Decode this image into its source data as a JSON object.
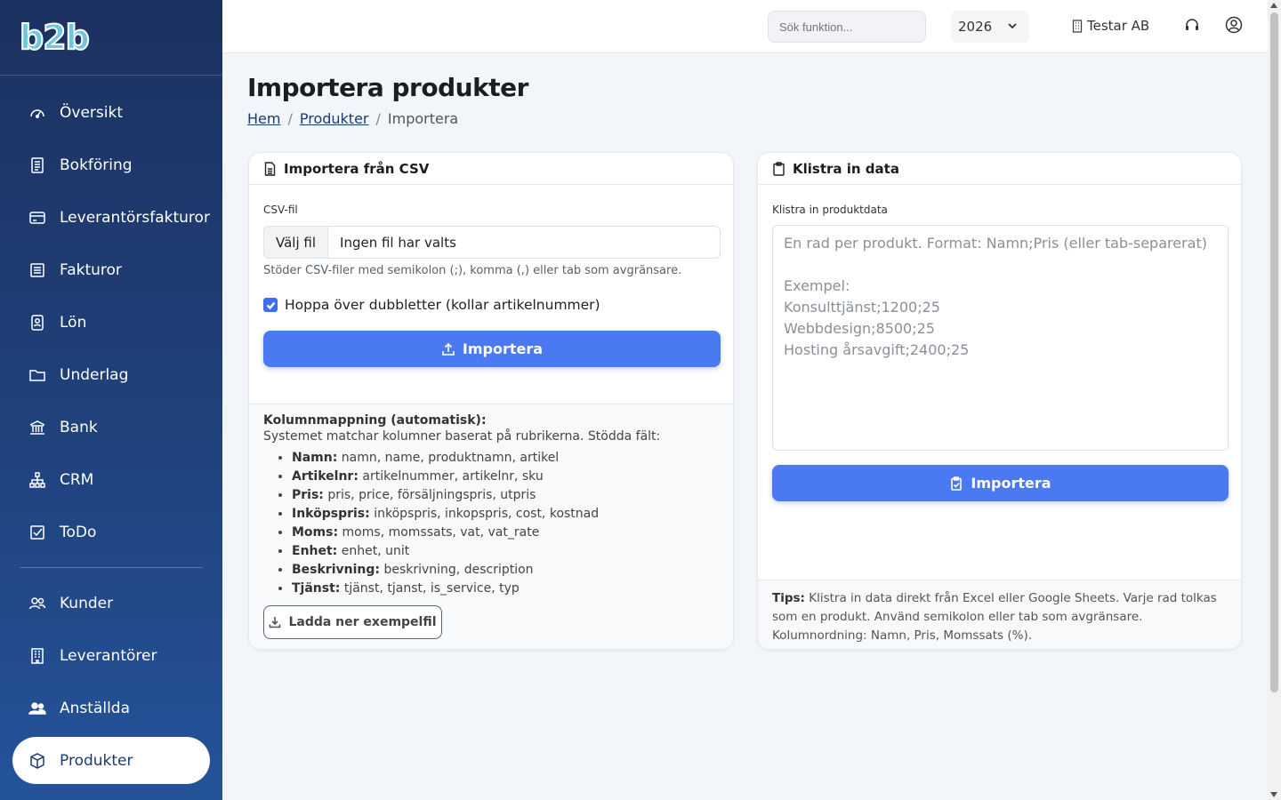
{
  "brand": {
    "logo_text": "b2b"
  },
  "sidebar": {
    "items": [
      {
        "label": "Översikt",
        "icon": "gauge-icon"
      },
      {
        "label": "Bokföring",
        "icon": "ledger-icon"
      },
      {
        "label": "Leverantörsfakturor",
        "icon": "credit-card-icon"
      },
      {
        "label": "Fakturor",
        "icon": "invoice-icon"
      },
      {
        "label": "Lön",
        "icon": "payroll-icon"
      },
      {
        "label": "Underlag",
        "icon": "folder-icon"
      },
      {
        "label": "Bank",
        "icon": "bank-icon"
      },
      {
        "label": "CRM",
        "icon": "diagram-icon"
      },
      {
        "label": "ToDo",
        "icon": "checkbox-icon"
      }
    ],
    "items2": [
      {
        "label": "Kunder",
        "icon": "users-icon"
      },
      {
        "label": "Leverantörer",
        "icon": "building-icon"
      },
      {
        "label": "Anställda",
        "icon": "people-icon"
      },
      {
        "label": "Produkter",
        "icon": "box-icon",
        "active": true
      }
    ]
  },
  "topbar": {
    "search_placeholder": "Sök funktion...",
    "year": "2026",
    "company": "Testar AB"
  },
  "page": {
    "title": "Importera produkter",
    "breadcrumb": {
      "home": "Hem",
      "parent": "Produkter",
      "current": "Importera",
      "separator": "/"
    }
  },
  "csv_card": {
    "header": "Importera från CSV",
    "file_label": "CSV-fil",
    "file_button": "Välj fil",
    "file_status": "Ingen fil har valts",
    "help": "Stöder CSV-filer med semikolon (;), komma (,) eller tab som avgränsare.",
    "checkbox_label": "Hoppa över dubbletter (kollar artikelnummer)",
    "checkbox_checked": true,
    "import_button": "Importera",
    "mapping_title": "Kolumnmappning (automatisk):",
    "mapping_desc": "Systemet matchar kolumner baserat på rubrikerna. Stödda fält:",
    "mapping_fields": [
      {
        "name": "Namn:",
        "values": "namn, name, produktnamn, artikel"
      },
      {
        "name": "Artikelnr:",
        "values": "artikelnummer, artikelnr, sku"
      },
      {
        "name": "Pris:",
        "values": "pris, price, försäljningspris, utpris"
      },
      {
        "name": "Inköpspris:",
        "values": "inköpspris, inkopspris, cost, kostnad"
      },
      {
        "name": "Moms:",
        "values": "moms, momssats, vat, vat_rate"
      },
      {
        "name": "Enhet:",
        "values": "enhet, unit"
      },
      {
        "name": "Beskrivning:",
        "values": "beskrivning, description"
      },
      {
        "name": "Tjänst:",
        "values": "tjänst, tjanst, is_service, typ"
      }
    ],
    "download_button": "Ladda ner exempelfil"
  },
  "paste_card": {
    "header": "Klistra in data",
    "label": "Klistra in produktdata",
    "placeholder": "En rad per produkt. Format: Namn;Pris (eller tab-separerat)\n\nExempel:\nKonsulttjänst;1200;25\nWebbdesign;8500;25\nHosting årsavgift;2400;25",
    "import_button": "Importera",
    "tips_label": "Tips:",
    "tips_text": "Klistra in data direkt från Excel eller Google Sheets. Varje rad tolkas som en produkt. Använd semikolon eller tab som avgränsare. Kolumnordning: Namn, Pris, Momssats (%)."
  },
  "colors": {
    "primary": "#4a79f2",
    "sidebar": "#1f3a6e",
    "brand_accent": "#6ec7dd"
  }
}
